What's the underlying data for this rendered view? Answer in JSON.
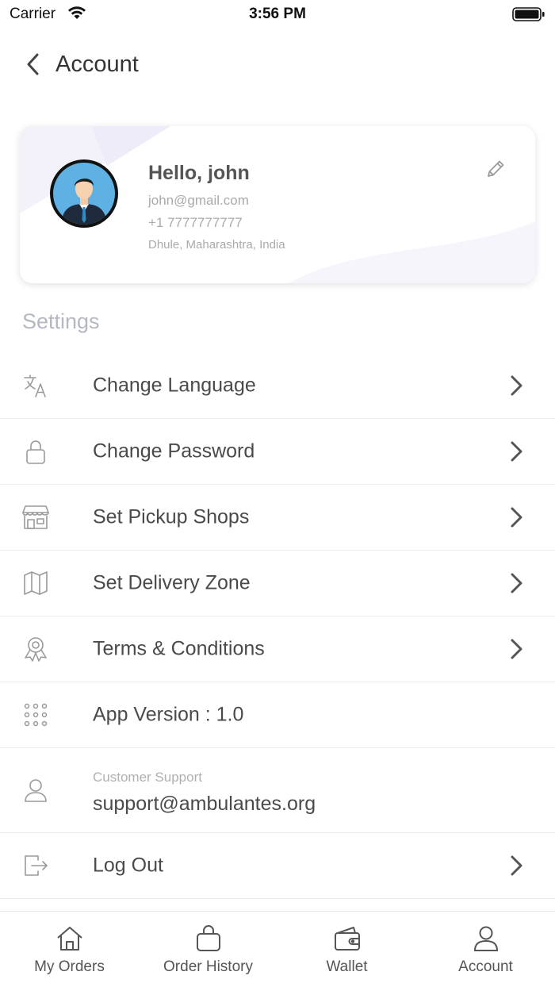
{
  "status_bar": {
    "carrier": "Carrier",
    "time": "3:56 PM"
  },
  "header": {
    "title": "Account"
  },
  "profile": {
    "greeting": "Hello, john",
    "email": "john@gmail.com",
    "phone": "+1 7777777777",
    "address": "Dhule, Maharashtra, India"
  },
  "settings": {
    "title": "Settings",
    "items": [
      {
        "label": "Change Language",
        "icon": "translate-icon"
      },
      {
        "label": "Change Password",
        "icon": "lock-icon"
      },
      {
        "label": "Set Pickup Shops",
        "icon": "store-icon"
      },
      {
        "label": "Set Delivery Zone",
        "icon": "map-icon"
      },
      {
        "label": "Terms & Conditions",
        "icon": "award-icon"
      },
      {
        "label": "App Version : 1.0",
        "icon": "grid-dots-icon"
      }
    ],
    "support": {
      "label": "Customer Support",
      "value": "support@ambulantes.org",
      "icon": "user-icon"
    },
    "logout": {
      "label": "Log Out",
      "icon": "logout-icon"
    }
  },
  "tabs": [
    {
      "label": "My Orders",
      "icon": "home-icon"
    },
    {
      "label": "Order History",
      "icon": "bag-icon"
    },
    {
      "label": "Wallet",
      "icon": "wallet-icon"
    },
    {
      "label": "Account",
      "icon": "user-icon"
    }
  ],
  "colors": {
    "text": "#4a4a4a",
    "muted": "#aaaaaa",
    "section": "#b4b8c3",
    "divider": "#ececec",
    "accent_bg": "#f2f1fb"
  }
}
